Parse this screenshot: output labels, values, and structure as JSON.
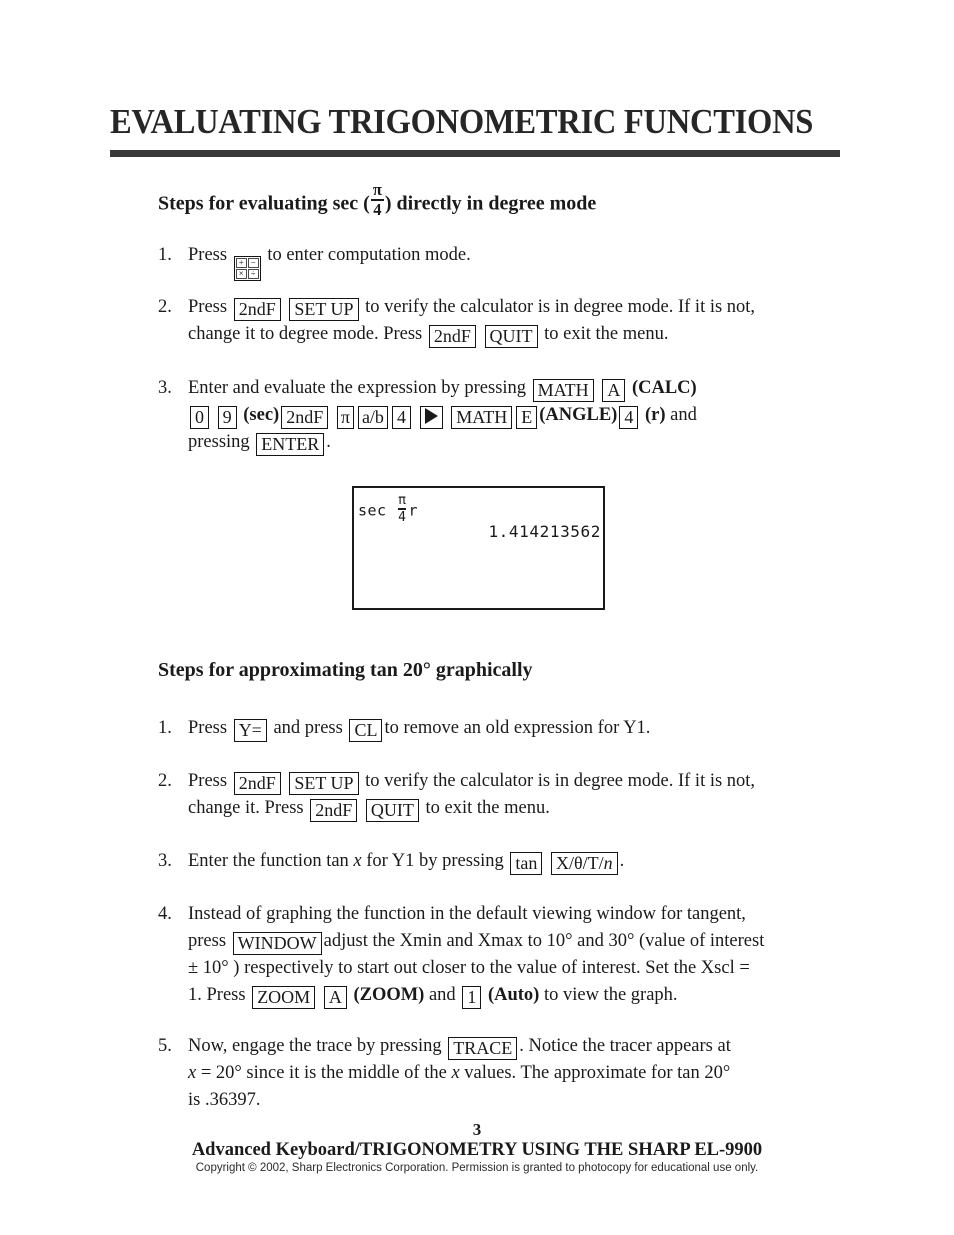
{
  "document": {
    "title": "EVALUATING TRIGONOMETRIC FUNCTIONS"
  },
  "sections": [
    {
      "heading_prefix": "Steps for evaluating sec (",
      "heading_numerator": "π",
      "heading_denominator": "4",
      "heading_suffix": ") directly in degree mode",
      "steps": [
        {
          "number": "1.",
          "text_before_key": "Press",
          "mode_key_cells": [
            "+",
            "−",
            "×",
            "÷"
          ],
          "text_after_key": "to enter computation mode."
        },
        {
          "number": "2.",
          "line1_a": "Press",
          "line1_key1": "2ndF",
          "line1_key2": "SET UP",
          "line1_b": "to verify the calculator is in degree mode.  If it is not,",
          "line2_a": "change it to degree mode.  Press",
          "line2_key1": "2ndF",
          "line2_key2": "QUIT",
          "line2_b": "to exit the menu."
        },
        {
          "number": "3.",
          "line1_a": "Enter and evaluate the expression by pressing",
          "line1_key1": "MATH",
          "line1_key2": "A",
          "line1_b": "(CALC)",
          "line2_key1": "0",
          "line2_key2": "9",
          "line2_a": "(sec)",
          "line2_key3": "2ndF",
          "line2_key4": "π",
          "line2_key5": "a/b",
          "line2_key6": "4",
          "line2_key7": "right-triangle-icon",
          "line2_key8": "MATH",
          "line2_key9": "E",
          "line2_b": "(ANGLE)",
          "line2_key10": "4",
          "line2_c": "(r)",
          "line2_d": "and",
          "line3_a": "pressing",
          "line3_key1": "ENTER",
          "line3_b": "."
        }
      ]
    },
    {
      "heading": "Steps for approximating tan 20° graphically",
      "steps": [
        {
          "number": "1.",
          "a": "Press",
          "key1": "Y=",
          "b": "and press",
          "key2": "CL",
          "c": "to remove an old expression for Y1."
        },
        {
          "number": "2.",
          "line1_a": "Press",
          "line1_key1": "2ndF",
          "line1_key2": "SET UP",
          "line1_b": "to verify the calculator is in degree mode.  If it is not,",
          "line2_a": "change it.  Press",
          "line2_key1": "2ndF",
          "line2_key2": "QUIT",
          "line2_b": "to exit the menu."
        },
        {
          "number": "3.",
          "a": "Enter the function tan",
          "italic_x": "x",
          "b": "for Y1 by pressing",
          "key1": "tan",
          "key2_prefix": "X/θ/T/",
          "key2_italic": "n",
          "c": "."
        },
        {
          "number": "4.",
          "line1": "Instead of graphing the function in the default viewing window for tangent,",
          "line2_a": "press",
          "line2_key1": "WINDOW",
          "line2_b": "adjust the Xmin and Xmax to 10° and 30° (value of interest",
          "line3": "± 10° ) respectively to start out closer to the value of interest.  Set the Xscl =",
          "line4_a": "1.  Press",
          "line4_key1": "ZOOM",
          "line4_key2": "A",
          "line4_b": "(ZOOM)",
          "line4_c": "and",
          "line4_key3": "1",
          "line4_d": "(Auto)",
          "line4_e": "to view the graph."
        },
        {
          "number": "5.",
          "line1_a": "Now, engage the trace by pressing",
          "line1_key1": "TRACE",
          "line1_b": ".  Notice the tracer appears at",
          "line2_x1": "x",
          "line2_a": "= 20° since it is the middle of the",
          "line2_x2": "x",
          "line2_b": "values.  The approximate for tan 20°",
          "line3": "is .36397."
        }
      ]
    }
  ],
  "calculator_screen": {
    "expression_function": "sec",
    "expression_numerator": "π",
    "expression_denominator": "4",
    "expression_unit": "r",
    "result": "1.414213562"
  },
  "footer": {
    "page_number": "3",
    "title": "Advanced Keyboard/TRIGONOMETRY USING THE SHARP EL-9900",
    "copyright": "Copyright © 2002, Sharp Electronics Corporation.  Permission is granted to photocopy for educational use only."
  },
  "colors": {
    "text": "#1a1a1a",
    "rule": "#3a3a3a",
    "background": "#ffffff"
  }
}
